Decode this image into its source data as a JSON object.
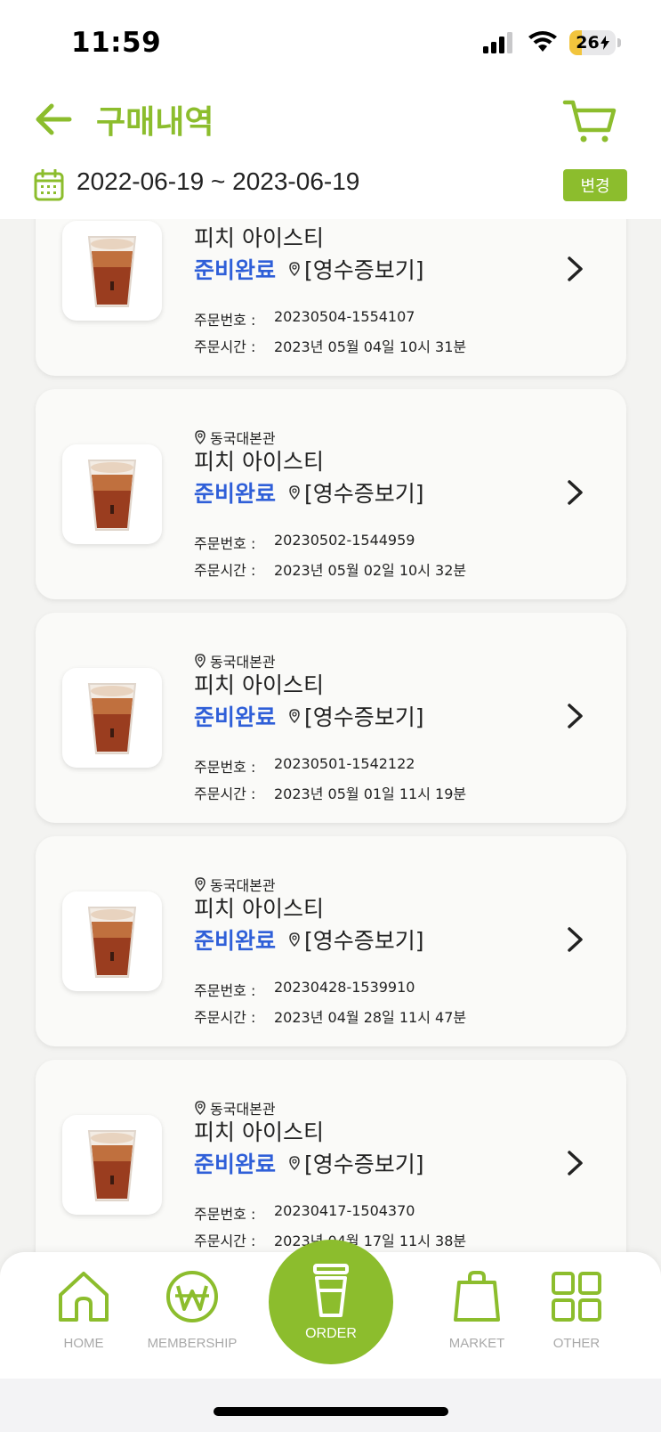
{
  "status_bar": {
    "time": "11:59",
    "battery_level": "26"
  },
  "header": {
    "title": "구매내역",
    "date_range": "2022-06-19 ~ 2023-06-19",
    "change_label": "변경"
  },
  "colors": {
    "accent": "#8cbd2d",
    "status_blue": "#2f5fd8"
  },
  "orders": [
    {
      "store": "",
      "product": "피치 아이스티",
      "status": "준비완료",
      "receipt": "[영수증보기]",
      "order_no_label": "주문번호 :",
      "order_no": "20230504-1554107",
      "order_time_label": "주문시간 :",
      "order_time": "2023년 05월 04일 10시 31분"
    },
    {
      "store": "동국대본관",
      "product": "피치 아이스티",
      "status": "준비완료",
      "receipt": "[영수증보기]",
      "order_no_label": "주문번호 :",
      "order_no": "20230502-1544959",
      "order_time_label": "주문시간 :",
      "order_time": "2023년 05월 02일 10시 32분"
    },
    {
      "store": "동국대본관",
      "product": "피치 아이스티",
      "status": "준비완료",
      "receipt": "[영수증보기]",
      "order_no_label": "주문번호 :",
      "order_no": "20230501-1542122",
      "order_time_label": "주문시간 :",
      "order_time": "2023년 05월 01일 11시 19분"
    },
    {
      "store": "동국대본관",
      "product": "피치 아이스티",
      "status": "준비완료",
      "receipt": "[영수증보기]",
      "order_no_label": "주문번호 :",
      "order_no": "20230428-1539910",
      "order_time_label": "주문시간 :",
      "order_time": "2023년 04월 28일 11시 47분"
    },
    {
      "store": "동국대본관",
      "product": "피치 아이스티",
      "status": "준비완료",
      "receipt": "[영수증보기]",
      "order_no_label": "주문번호 :",
      "order_no": "20230417-1504370",
      "order_time_label": "주문시간 :",
      "order_time": "2023년 04월 17일 11시 38분"
    }
  ],
  "nav": {
    "home": "HOME",
    "membership": "MEMBERSHIP",
    "order": "ORDER",
    "market": "MARKET",
    "other": "OTHER"
  }
}
